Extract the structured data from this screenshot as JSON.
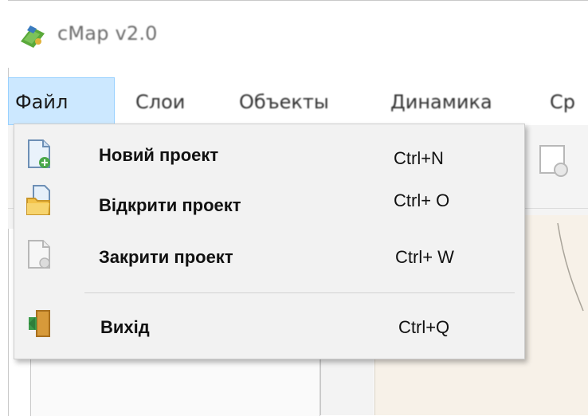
{
  "window": {
    "title": "cMap v2.0"
  },
  "menubar": {
    "items": [
      {
        "label": "Файл",
        "access_key": ""
      },
      {
        "label": "Слои",
        "access_key": ""
      },
      {
        "label": "Объекты",
        "access_key": ""
      },
      {
        "label": "Динамика",
        "access_key": ""
      },
      {
        "label": "Ср",
        "access_key": ""
      }
    ]
  },
  "file_menu": {
    "items": [
      {
        "label": "Новий проект",
        "shortcut": "Ctrl+N",
        "icon": "new-document-icon"
      },
      {
        "label": "Відкрити проект",
        "shortcut": "Ctrl+ O",
        "icon": "open-folder-icon"
      },
      {
        "label": "Закрити проект",
        "shortcut": "Ctrl+ W",
        "icon": "close-document-icon"
      },
      {
        "label": "Вихід",
        "shortcut": "Ctrl+Q",
        "icon": "exit-door-icon"
      }
    ]
  },
  "colors": {
    "menu_active_bg": "#cce8ff",
    "menu_active_border": "#99d1ff",
    "dropdown_bg": "#f2f2f2"
  }
}
